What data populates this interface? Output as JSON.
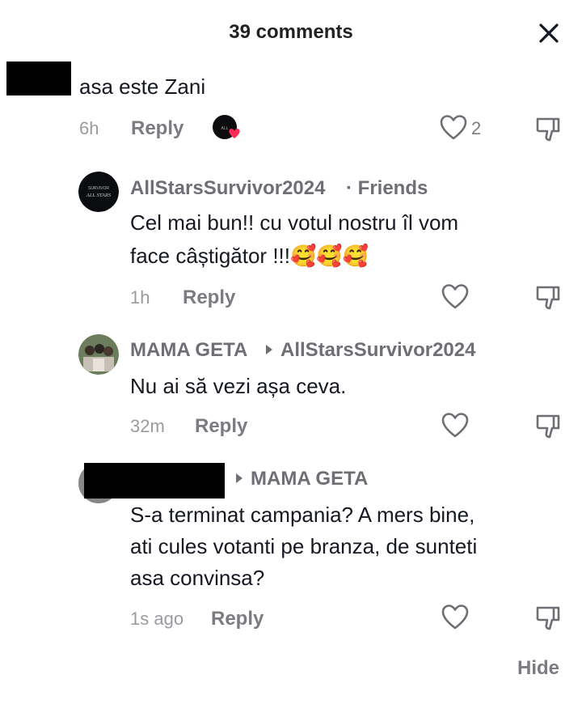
{
  "header": {
    "title": "39 comments"
  },
  "comments": [
    {
      "text": "asa este Zani",
      "time": "6h",
      "reply": "Reply",
      "likes": "2"
    },
    {
      "author": "AllStarsSurvivor2024",
      "tag": "· Friends",
      "text_line1": "Cel mai bun!! cu votul nostru îl vom",
      "text_line2": "face câștigător !!!🥰🥰🥰",
      "time": "1h",
      "reply": "Reply",
      "avatar_text_top": "SURVIVOR",
      "avatar_text_bottom": "ALL STARS"
    },
    {
      "author": "MAMA GETA",
      "reply_to": "AllStarsSurvivor2024",
      "text": "Nu ai să vezi așa ceva.",
      "time": "32m",
      "reply": "Reply"
    },
    {
      "reply_to": "MAMA GETA",
      "text_line1": "S-a terminat campania? A mers bine,",
      "text_line2": "ati cules votanti pe branza, de sunteti",
      "text_line3": "asa convinsa?",
      "time": "1s ago",
      "reply": "Reply"
    }
  ],
  "footer": {
    "hide": "Hide"
  },
  "icons": {
    "close": "close-icon",
    "heart": "heart-icon",
    "dislike": "thumbs-down-icon"
  }
}
